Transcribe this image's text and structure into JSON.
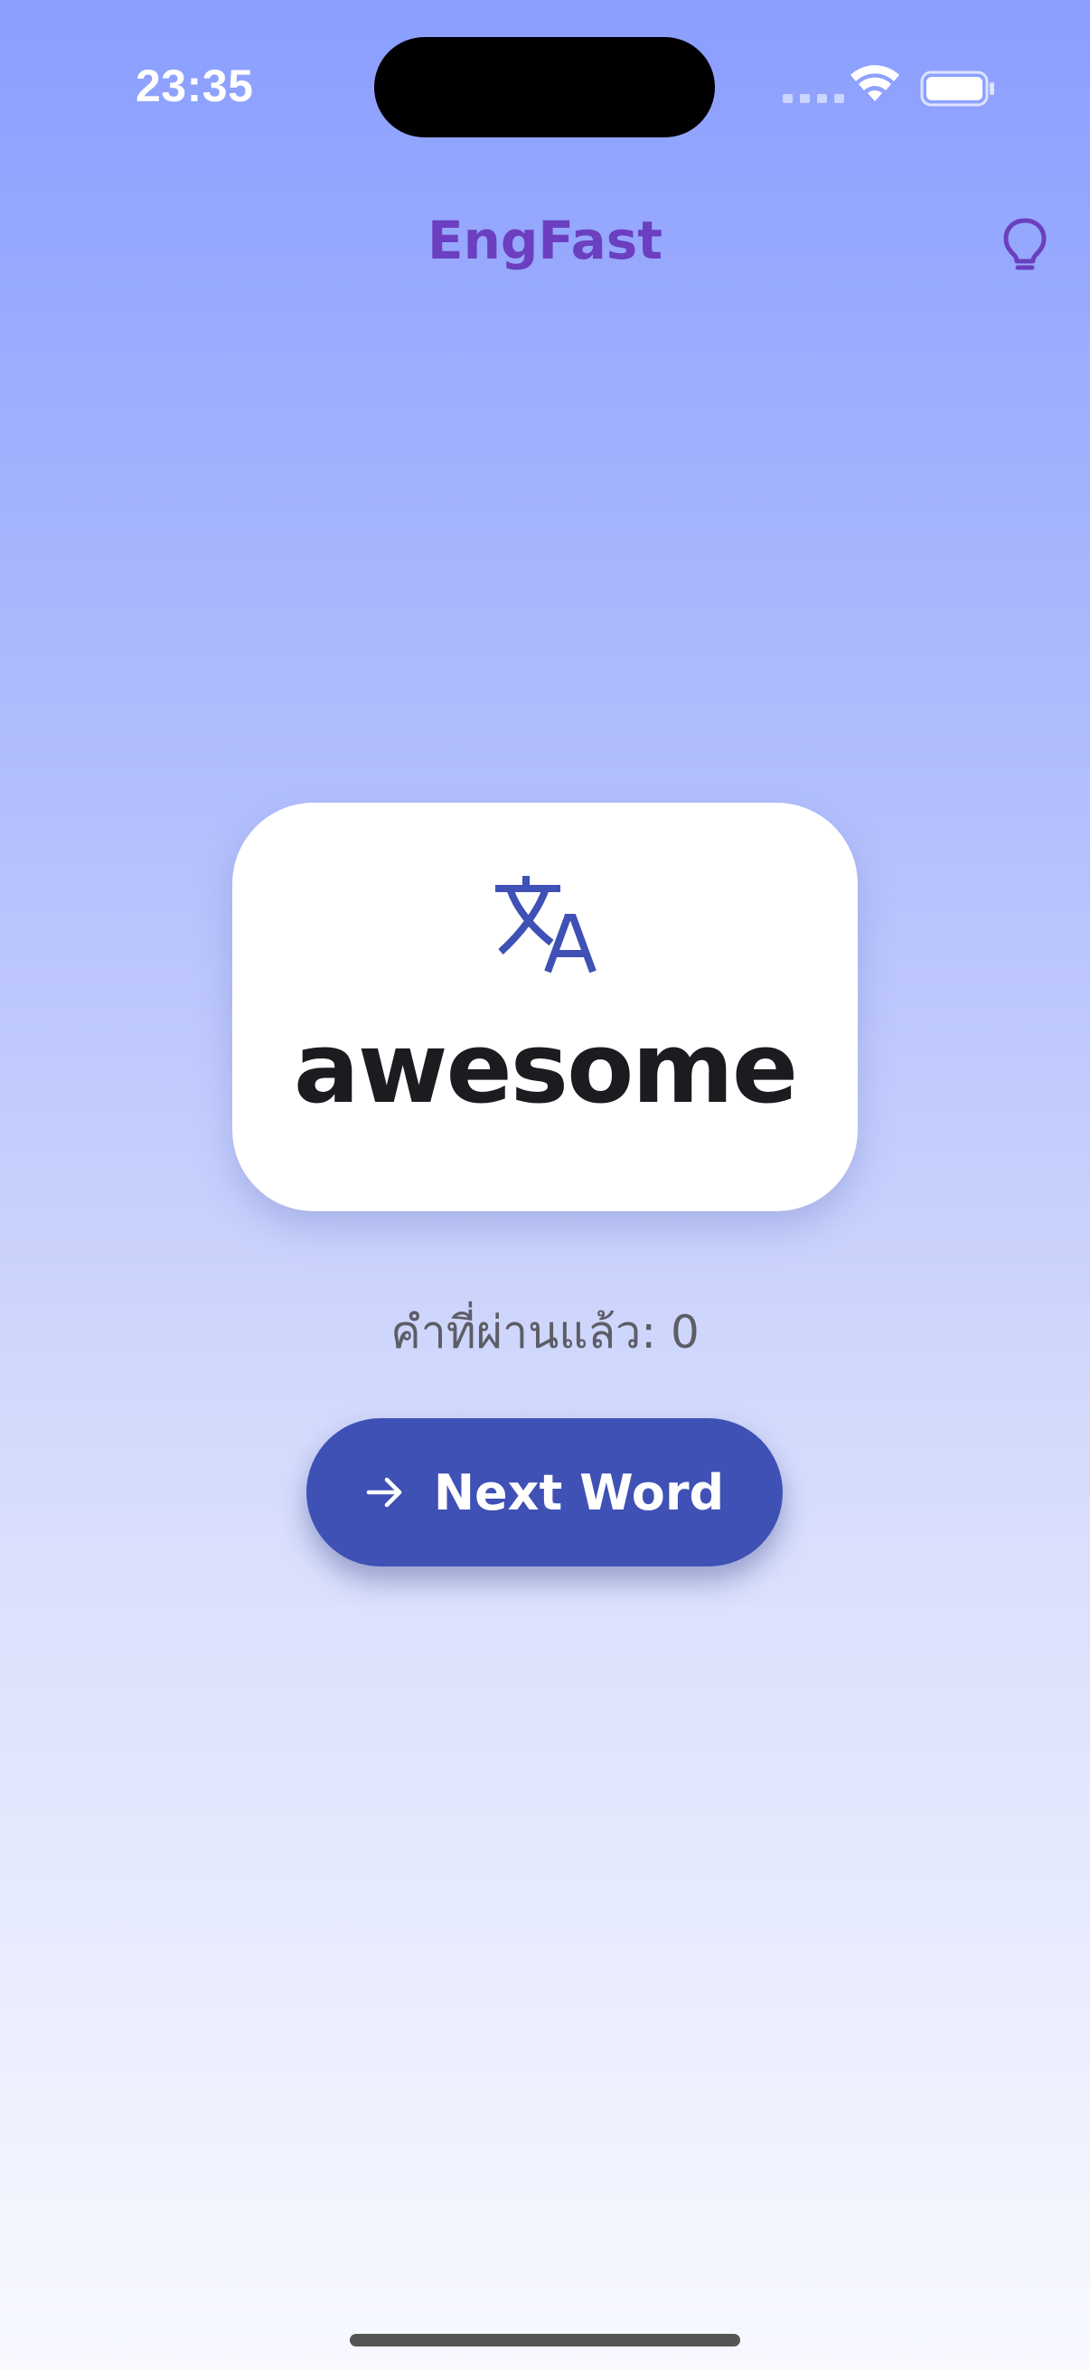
{
  "status_bar": {
    "time": "23:35",
    "icons": [
      "signal-icon",
      "wifi-icon",
      "battery-icon"
    ]
  },
  "header": {
    "title": "EngFast",
    "hint_icon": "lightbulb-icon"
  },
  "card": {
    "icon": "translate-icon",
    "word": "awesome"
  },
  "progress": {
    "label": "คำที่ผ่านแล้ว: 0"
  },
  "next_button": {
    "icon": "arrow-right-icon",
    "label": "Next Word"
  },
  "colors": {
    "accent": "#3f51b5",
    "title": "#6b3fbf",
    "background_top": "#8a9efe",
    "background_bottom": "#f8f9ff"
  }
}
